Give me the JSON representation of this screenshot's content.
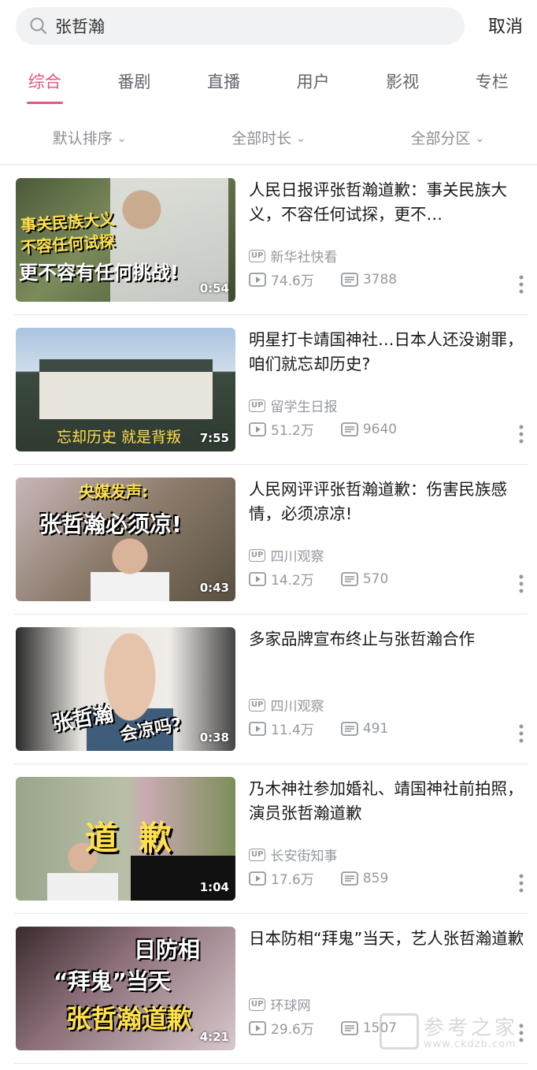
{
  "search": {
    "query": "张哲瀚",
    "cancel_label": "取消"
  },
  "tabs": [
    {
      "label": "综合",
      "active": true
    },
    {
      "label": "番剧",
      "active": false
    },
    {
      "label": "直播",
      "active": false
    },
    {
      "label": "用户",
      "active": false
    },
    {
      "label": "影视",
      "active": false
    },
    {
      "label": "专栏",
      "active": false
    }
  ],
  "filters": [
    {
      "label": "默认排序"
    },
    {
      "label": "全部时长"
    },
    {
      "label": "全部分区"
    }
  ],
  "accent_color": "#e4567f",
  "results": [
    {
      "title": "人民日报评张哲瀚道歉：事关民族大义，不容任何试探，更不…",
      "author": "新华社快看",
      "views": "74.6万",
      "danmaku": "3788",
      "duration": "0:54",
      "thumb_text": [
        "事关民族大义",
        "不容任何试探",
        "更不容有任何挑战!"
      ]
    },
    {
      "title": "明星打卡靖国神社…日本人还没谢罪，咱们就忘却历史?",
      "author": "留学生日报",
      "views": "51.2万",
      "danmaku": "9640",
      "duration": "7:55",
      "thumb_text": [
        "忘却历史 就是背叛"
      ]
    },
    {
      "title": "人民网评评张哲瀚道歉：伤害民族感情，必须凉凉!",
      "author": "四川观察",
      "views": "14.2万",
      "danmaku": "570",
      "duration": "0:43",
      "thumb_text": [
        "央媒发声:",
        "张哲瀚必须凉!"
      ]
    },
    {
      "title": "多家品牌宣布终止与张哲瀚合作",
      "author": "四川观察",
      "views": "11.4万",
      "danmaku": "491",
      "duration": "0:38",
      "thumb_text": [
        "张哲瀚",
        "会凉吗?"
      ]
    },
    {
      "title": "乃木神社参加婚礼、靖国神社前拍照，演员张哲瀚道歉",
      "author": "长安街知事",
      "views": "17.6万",
      "danmaku": "859",
      "duration": "1:04",
      "thumb_text": [
        "道",
        "歉"
      ]
    },
    {
      "title": "日本防相“拜鬼”当天，艺人张哲瀚道歉",
      "author": "环球网",
      "views": "29.6万",
      "danmaku": "1507",
      "duration": "4:21",
      "thumb_text": [
        "日防相",
        "“拜鬼”当天",
        "张哲瀚道歉"
      ]
    }
  ],
  "watermark": {
    "text": "参考之家",
    "url": "www.ckdzb.com"
  }
}
